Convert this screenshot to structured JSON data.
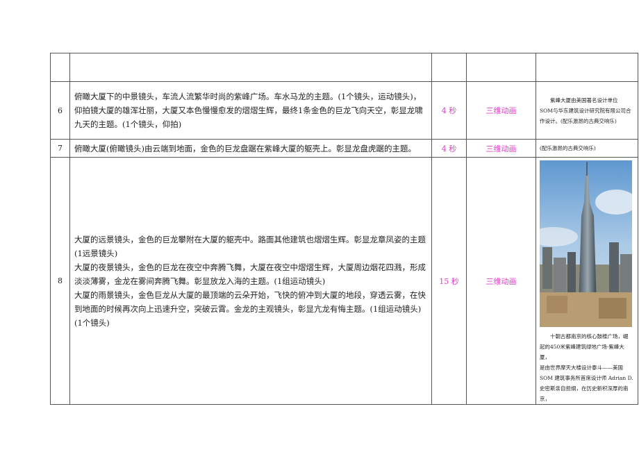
{
  "rows": [
    {
      "num": "",
      "desc": [],
      "duration": "",
      "type": "",
      "notes": []
    },
    {
      "num": "6",
      "desc": [
        "俯瞰大厦下的中景镜头，车流人流繁华时尚的紫峰广场。车水马龙的主题。(1个镜头，运动镜头)，",
        "仰拍镜大厦的雄浑壮丽，大厦又本色慢慢愈发的熠熠生辉，最终1条金色的巨龙飞向天空，彰显龙啸",
        "九天的主题。(1个镜头，仰拍)"
      ],
      "duration": "4 秒",
      "type": "三维动画",
      "notes": [
        "紫峰大厦由美国著名设计单位",
        "SOM与华东建筑设计研究院有限公司合",
        "作设计。(配乐激昂的古典交响乐)"
      ]
    },
    {
      "num": "7",
      "desc": [
        "俯瞰大厦(俯瞰镜头)由云端到地面，金色的巨龙盘踞在紫峰大厦的躯壳上。彰显龙盘虎踞的主题。"
      ],
      "duration": "4 秒",
      "type": "三维动画",
      "notes": [
        "(配乐激昂的古典交响乐)"
      ]
    },
    {
      "num": "8",
      "desc": [
        "大厦的远景镜头，金色的巨龙攀附在大厦的躯壳中。路面其他建筑也熠熠生辉。彰显龙章凤姿的主题",
        "(1远景镜头)",
        "大厦的夜景镜头，金色的巨龙在夜空中奔腾飞舞，大厦在夜空中熠熠生辉，大厦周边烟花四溅，形成",
        "淡淡薄雾，金龙在雾间奔腾飞舞。彰显放龙入海的主题。(1组运动镜头)",
        "大厦的雨景镜头，金色巨龙从大厦的最顶端的云朵开始，飞快的俯冲到大厦的地段，穿透云雾，在快",
        "到地面的时候再次向上迅速升空，突破云霄。金龙的主观镜头，彰显亢龙有悔主题。(1组运动镜头)",
        "(1个镜头)"
      ],
      "duration": "15 秒",
      "type": "三维动画",
      "notes": [
        "十朝古都南京的核心鼓楼广场，崛",
        "起的450米紫峰建筑绿地广场·紫峰大厦，",
        "是由世界摩天大楼设计泰斗——美国",
        "SOM 建筑事务所首席设计师 Adrian D.",
        "史密斯亲自担纲，在历史新积深厚的南京，"
      ]
    }
  ],
  "colors": {
    "accent": "#e040c8",
    "border": "#555555"
  }
}
